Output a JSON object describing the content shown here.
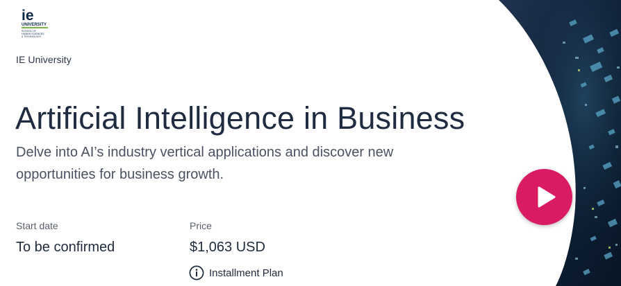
{
  "header": {
    "logo": {
      "mark": "ie",
      "word": "UNIVERSITY",
      "school_lines": [
        "SCHOOL OF",
        "HUMAN SCIENCES",
        "& TECHNOLOGY"
      ],
      "accent_color": "#7ab648"
    },
    "org_name": "IE University"
  },
  "course": {
    "title": "Artificial Intelligence in Business",
    "subtitle": "Delve into AI’s industry vertical applications and discover new opportunities for business growth."
  },
  "details": {
    "start_date_label": "Start date",
    "start_date_value": "To be confirmed",
    "price_label": "Price",
    "price_value": "$1,063 USD",
    "installment_label": "Installment Plan",
    "installment_icon": "info-icon"
  },
  "hero": {
    "play_icon": "play-icon",
    "play_button_color": "#d81b62",
    "background_color": "#0d1e33"
  }
}
